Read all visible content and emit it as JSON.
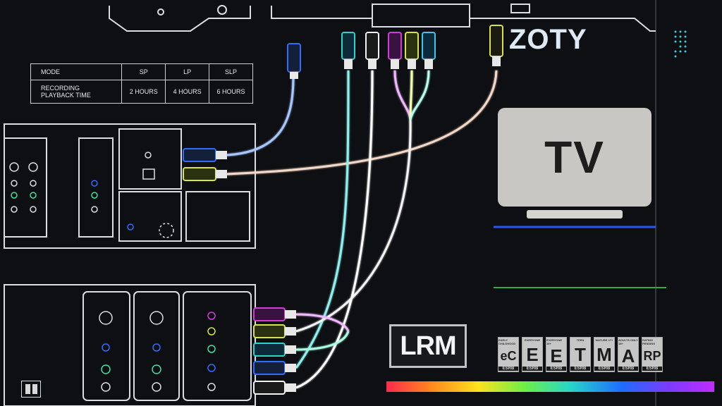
{
  "recording_table": {
    "headers": [
      "MODE",
      "SP",
      "LP",
      "SLP"
    ],
    "row_label_line1": "RECORDING",
    "row_label_line2": "PLAYBACK TIME",
    "values": [
      "2 HOURS",
      "4 HOURS",
      "6 HOURS"
    ]
  },
  "brand": "ZOTY",
  "tv_label": "TV",
  "lrm_label": "LRM",
  "ratings": [
    {
      "top": "EARLY CHILDHOOD",
      "letter": "eC"
    },
    {
      "top": "EVERYONE",
      "letter": "E"
    },
    {
      "top": "EVERYONE 10+",
      "letter": "E"
    },
    {
      "top": "TEEN",
      "letter": "T"
    },
    {
      "top": "MATURE 17+",
      "letter": "M"
    },
    {
      "top": "ADULTS ONLY 18+",
      "letter": "A"
    },
    {
      "top": "RATING PENDING",
      "letter": "RP"
    }
  ],
  "rating_footer": "ESRB",
  "colors": {
    "cable_blue": "#2f6cff",
    "cable_yellow": "#d8e24a",
    "cable_magenta": "#d23bd6",
    "cable_green": "#3fe0a0",
    "cable_white": "#f2f2f2",
    "outline": "#d9dde2"
  }
}
